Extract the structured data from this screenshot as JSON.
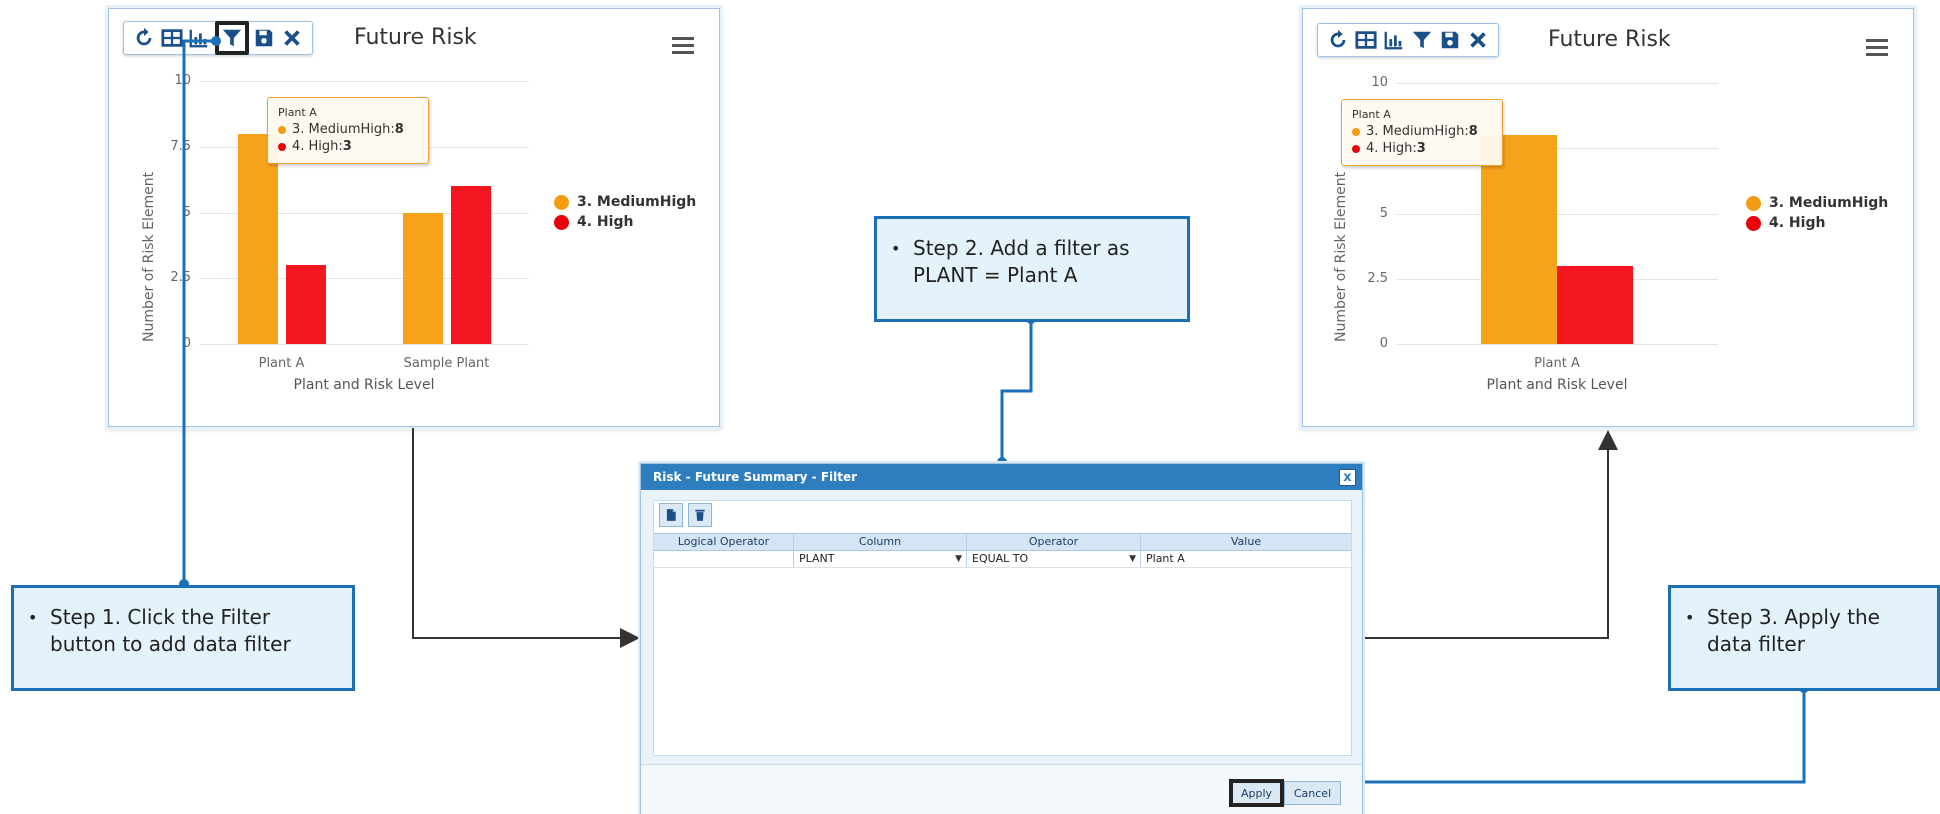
{
  "left_panel": {
    "title": "Future Risk",
    "toolbar_icons": [
      "refresh-icon",
      "table-icon",
      "chart-icon",
      "filter-icon",
      "save-icon",
      "close-icon"
    ],
    "tooltip": {
      "title": "Plant A",
      "rows": [
        {
          "label": "3. MediumHigh: ",
          "value": "8",
          "color": "#f39c12"
        },
        {
          "label": "4. High: ",
          "value": "3",
          "color": "#e8000b"
        }
      ]
    }
  },
  "right_panel": {
    "title": "Future Risk",
    "toolbar_icons": [
      "refresh-icon",
      "table-icon",
      "chart-icon",
      "filter-icon",
      "save-icon",
      "close-icon"
    ],
    "tooltip": {
      "title": "Plant A",
      "rows": [
        {
          "label": "3. MediumHigh: ",
          "value": "8",
          "color": "#f39c12"
        },
        {
          "label": "4. High: ",
          "value": "3",
          "color": "#e8000b"
        }
      ]
    }
  },
  "chart_data": [
    {
      "type": "bar",
      "title": "Future Risk",
      "xlabel": "Plant and Risk Level",
      "ylabel": "Number of Risk Element",
      "categories": [
        "Plant A",
        "Sample Plant"
      ],
      "series": [
        {
          "name": "3. MediumHigh",
          "values": [
            8,
            5
          ],
          "color": "#f7a21b"
        },
        {
          "name": "4. High",
          "values": [
            3,
            6
          ],
          "color": "#f4161e"
        }
      ],
      "ylim": [
        0,
        10
      ],
      "yticks": [
        "0",
        "2.5",
        "5",
        "7.5",
        "10"
      ],
      "grid": true,
      "legend_position": "right"
    },
    {
      "type": "bar",
      "title": "Future Risk",
      "xlabel": "Plant and Risk Level",
      "ylabel": "Number of Risk Element",
      "categories": [
        "Plant A"
      ],
      "series": [
        {
          "name": "3. MediumHigh",
          "values": [
            8
          ],
          "color": "#f7a21b"
        },
        {
          "name": "4. High",
          "values": [
            3
          ],
          "color": "#f4161e"
        }
      ],
      "ylim": [
        0,
        10
      ],
      "yticks": [
        "0",
        "2.5",
        "5",
        "7.5",
        "10"
      ],
      "grid": true,
      "legend_position": "right"
    }
  ],
  "legend": [
    {
      "label": "3. MediumHigh",
      "color": "#f39c12"
    },
    {
      "label": "4. High",
      "color": "#e8000b"
    }
  ],
  "callouts": {
    "step1": "Step 1. Click the Filter button to add data filter",
    "step2": "Step 2. Add a filter as PLANT = Plant A",
    "step3": "Step 3. Apply the data filter"
  },
  "dialog": {
    "title": "Risk - Future Summary - Filter",
    "close_label": "x",
    "columns": [
      "Logical Operator",
      "Column",
      "Operator",
      "Value"
    ],
    "row": {
      "logical_operator": "",
      "column": "PLANT",
      "operator": "EQUAL TO",
      "value": "Plant A"
    },
    "apply_label": "Apply",
    "cancel_label": "Cancel"
  }
}
